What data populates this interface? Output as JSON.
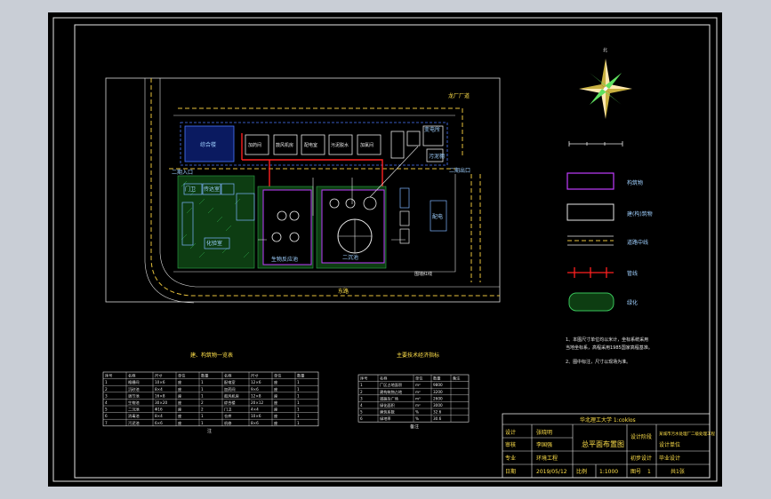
{
  "app": {
    "viewport_bg": "#c9ced6",
    "sheet_bg": "#000000"
  },
  "site": {
    "road_label_top": "龙厂厂道",
    "road_label_bottom": "东路",
    "gate_label_left": "二期入口",
    "gate_label_right": "二期出口",
    "boundary_note": "围墙红线"
  },
  "buildings": {
    "top_left": "综合楼",
    "row": [
      "加药间",
      "鼓风机房",
      "配电室",
      "污泥脱水",
      "加氯间"
    ],
    "top_right": [
      "机修",
      "仓库",
      "污泥棚",
      "变电所"
    ],
    "left_group": [
      "门卫",
      "传达室",
      "化验室",
      "办公楼",
      "宿舍",
      "食堂"
    ],
    "center_left": "生物反应池",
    "center_right": "二沉池",
    "right_small": [
      "泵房",
      "计量井",
      "出水井"
    ],
    "far_right": "配电"
  },
  "north": {
    "label": "北"
  },
  "legend": {
    "items": [
      {
        "name": "legend-building",
        "label": "构筑物"
      },
      {
        "name": "legend-structure",
        "label": "建(构)筑物"
      },
      {
        "name": "legend-road",
        "label": "道路中线"
      },
      {
        "name": "legend-pipe",
        "label": "管线"
      },
      {
        "name": "legend-green",
        "label": "绿化"
      }
    ],
    "notes": [
      "1、本图尺寸单位均以米计，坐标系统采用",
      "当地坐标系，高程采用1985国家高程基准。",
      "2、图中标注，尺寸以现场为准。"
    ]
  },
  "table1": {
    "title": "建、构筑物一览表",
    "headers": [
      "序号",
      "名称",
      "尺寸",
      "单位",
      "数量",
      "名称",
      "尺寸",
      "单位",
      "数量"
    ],
    "rows": [
      [
        "1",
        "格栅间",
        "10×6",
        "座",
        "1",
        "配电室",
        "12×6",
        "座",
        "1"
      ],
      [
        "2",
        "沉砂池",
        "8×4",
        "座",
        "1",
        "加药间",
        "9×6",
        "座",
        "1"
      ],
      [
        "3",
        "调节池",
        "16×8",
        "座",
        "1",
        "鼓风机房",
        "12×8",
        "座",
        "1"
      ],
      [
        "4",
        "生物池",
        "30×20",
        "座",
        "2",
        "综合楼",
        "20×12",
        "座",
        "1"
      ],
      [
        "5",
        "二沉池",
        "Φ16",
        "座",
        "2",
        "门卫",
        "4×4",
        "座",
        "1"
      ],
      [
        "6",
        "消毒池",
        "8×4",
        "座",
        "1",
        "仓库",
        "10×6",
        "座",
        "1"
      ],
      [
        "7",
        "污泥池",
        "6×6",
        "座",
        "1",
        "机修",
        "8×6",
        "座",
        "1"
      ]
    ],
    "footnote": "注"
  },
  "table2": {
    "title": "主要技术经济指标",
    "headers": [
      "序号",
      "名称",
      "单位",
      "数量",
      "备注"
    ],
    "rows": [
      [
        "1",
        "厂区占地面积",
        "m²",
        "9800",
        ""
      ],
      [
        "2",
        "建构筑物占地",
        "m²",
        "3200",
        ""
      ],
      [
        "3",
        "道路及广场",
        "m²",
        "2600",
        ""
      ],
      [
        "4",
        "绿化面积",
        "m²",
        "3000",
        ""
      ],
      [
        "5",
        "建筑系数",
        "%",
        "32.6",
        ""
      ],
      [
        "6",
        "绿地率",
        "%",
        "30.6",
        ""
      ]
    ],
    "footnote": "备注"
  },
  "titleblock": {
    "school": "华北理工大学 1:coklos",
    "drawing_title": "总平面布置图",
    "project": "某城市污水处理厂二级处理工程",
    "rows": [
      {
        "k": "设计",
        "v": "张晓明"
      },
      {
        "k": "审核",
        "v": "李国强"
      },
      {
        "k": "专业",
        "v": "环境工程"
      },
      {
        "k": "日期",
        "v": "2019/05/12"
      }
    ],
    "scale_label": "比例",
    "scale": "1:1000",
    "sheet_label": "图号",
    "sheet": "1",
    "count": "共1张",
    "mid_labels": [
      "设计阶段",
      "初步设计"
    ],
    "right_labels": [
      "设计单位",
      "毕业设计"
    ]
  }
}
